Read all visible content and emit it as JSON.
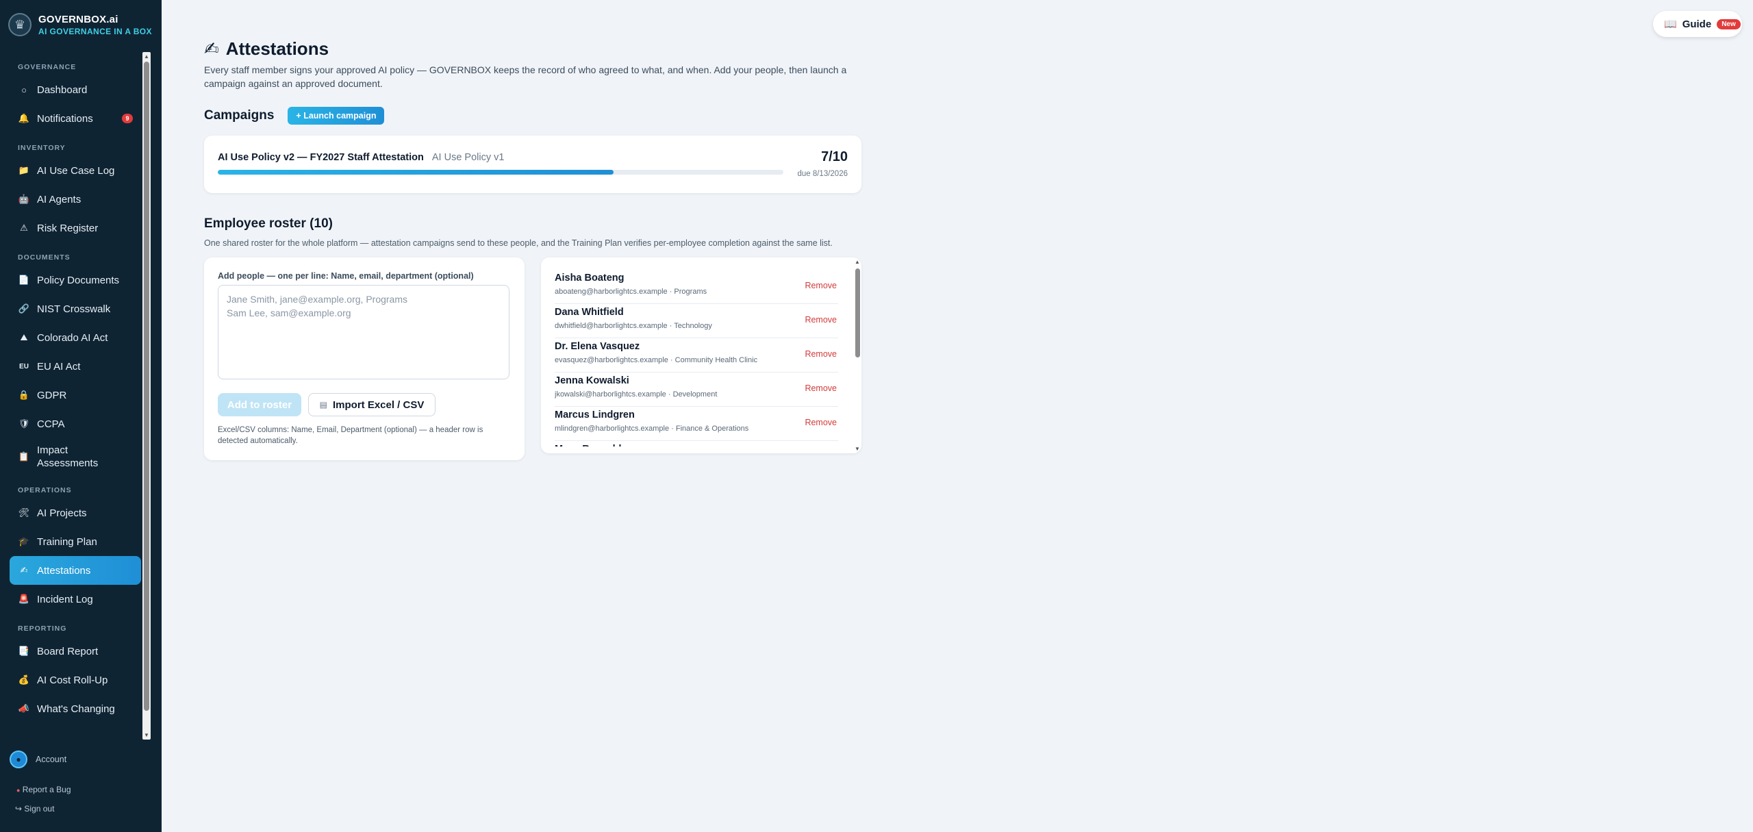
{
  "brand": {
    "name": "GOVERNBOX.ai",
    "tagline": "AI GOVERNANCE IN A BOX"
  },
  "sidebar": {
    "sections": [
      {
        "title": "GOVERNANCE",
        "items": [
          {
            "label": "Dashboard",
            "icon": "circle-icon"
          },
          {
            "label": "Notifications",
            "icon": "bell-icon",
            "badge": "9"
          }
        ]
      },
      {
        "title": "INVENTORY",
        "items": [
          {
            "label": "AI Use Case Log",
            "icon": "folder-icon"
          },
          {
            "label": "AI Agents",
            "icon": "robot-icon"
          },
          {
            "label": "Risk Register",
            "icon": "warning-icon"
          }
        ]
      },
      {
        "title": "DOCUMENTS",
        "items": [
          {
            "label": "Policy Documents",
            "icon": "document-icon"
          },
          {
            "label": "NIST Crosswalk",
            "icon": "link-icon"
          },
          {
            "label": "Colorado AI Act",
            "icon": "mountain-icon"
          },
          {
            "label": "EU AI Act",
            "icon": "eu-icon"
          },
          {
            "label": "GDPR",
            "icon": "lock-icon"
          },
          {
            "label": "CCPA",
            "icon": "shield-icon"
          },
          {
            "label": "Impact Assessments",
            "icon": "clipboard-icon"
          }
        ]
      },
      {
        "title": "OPERATIONS",
        "items": [
          {
            "label": "AI Projects",
            "icon": "tools-icon"
          },
          {
            "label": "Training Plan",
            "icon": "graduation-cap-icon"
          },
          {
            "label": "Attestations",
            "icon": "writing-hand-icon",
            "active": true
          },
          {
            "label": "Incident Log",
            "icon": "siren-icon"
          }
        ]
      },
      {
        "title": "REPORTING",
        "items": [
          {
            "label": "Board Report",
            "icon": "report-icon"
          },
          {
            "label": "AI Cost Roll-Up",
            "icon": "money-bag-icon"
          },
          {
            "label": "What's Changing",
            "icon": "megaphone-icon"
          }
        ]
      }
    ],
    "account": "Account",
    "report_bug": "Report a Bug",
    "sign_out": "Sign out"
  },
  "guide": {
    "label": "Guide",
    "badge": "New"
  },
  "page": {
    "title": "Attestations",
    "title_icon": "writing-hand-icon",
    "description": "Every staff member signs your approved AI policy — GOVERNBOX keeps the record of who agreed to what, and when. Add your people, then launch a campaign against an approved document."
  },
  "campaigns": {
    "heading": "Campaigns",
    "launch_label": "+ Launch campaign",
    "items": [
      {
        "name": "AI Use Policy v2 — FY2027 Staff Attestation",
        "document": "AI Use Policy v1",
        "count": "7/10",
        "progress": 0.7,
        "due": "due 8/13/2026"
      }
    ]
  },
  "roster": {
    "heading": "Employee roster (10)",
    "description": "One shared roster for the whole platform — attestation campaigns send to these people, and the Training Plan verifies per-employee completion against the same list.",
    "add_label": "Add people — one per line: Name, email, department (optional)",
    "placeholder": "Jane Smith, jane@example.org, Programs\nSam Lee, sam@example.org",
    "add_button": "Add to roster",
    "import_button": "Import Excel / CSV",
    "help": "Excel/CSV columns: Name, Email, Department (optional) — a header row is detected automatically.",
    "remove_label": "Remove",
    "people": [
      {
        "name": "Aisha Boateng",
        "meta": "aboateng@harborlightcs.example · Programs"
      },
      {
        "name": "Dana Whitfield",
        "meta": "dwhitfield@harborlightcs.example · Technology"
      },
      {
        "name": "Dr. Elena Vasquez",
        "meta": "evasquez@harborlightcs.example · Community Health Clinic"
      },
      {
        "name": "Jenna Kowalski",
        "meta": "jkowalski@harborlightcs.example · Development"
      },
      {
        "name": "Marcus Lindgren",
        "meta": "mlindgren@harborlightcs.example · Finance & Operations"
      },
      {
        "name": "Maya Reynolds",
        "meta": ""
      }
    ]
  }
}
